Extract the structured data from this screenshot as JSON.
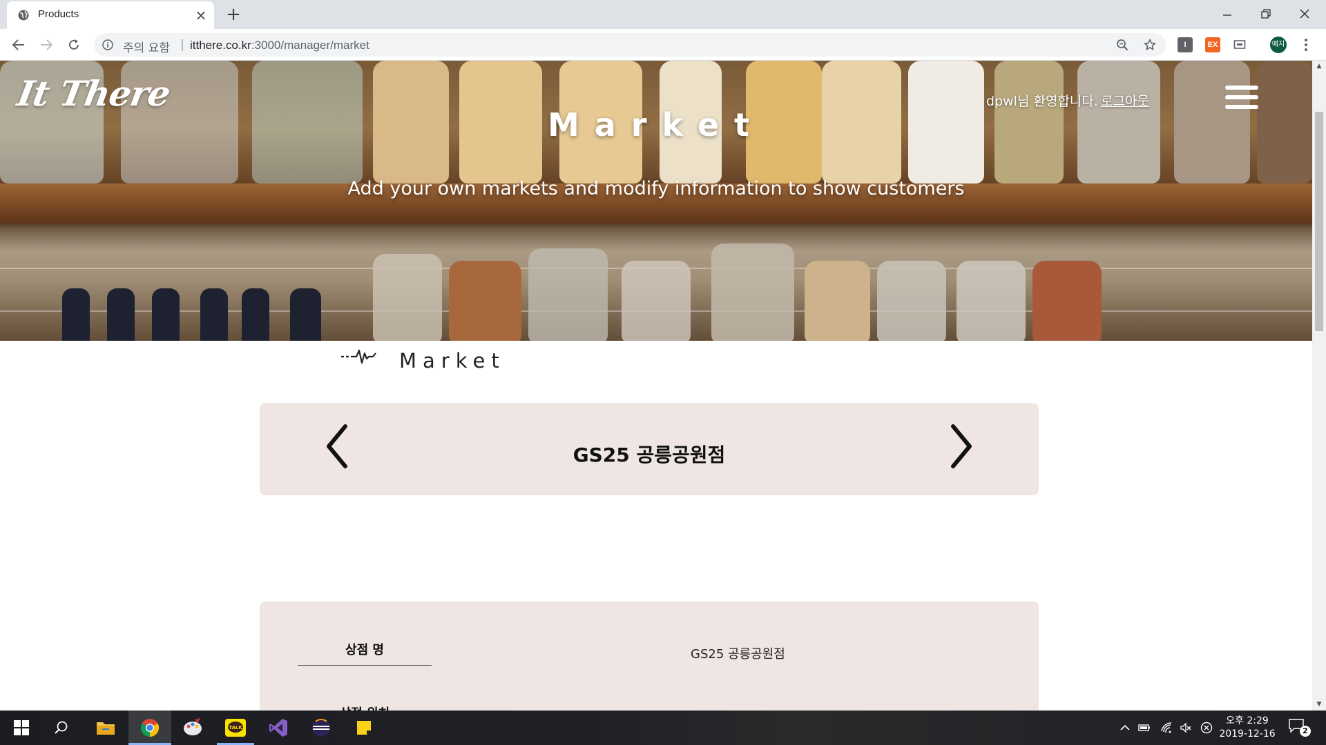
{
  "browser": {
    "tab_title": "Products",
    "security_label": "주의 요함",
    "url_host": "itthere.co.kr",
    "url_path": ":3000/manager/market",
    "profile_initials": "예지",
    "extensions": [
      {
        "name": "extension-i",
        "label": "I",
        "color": "#5f6368"
      },
      {
        "name": "extension-ex",
        "label": "EX",
        "color": "#f26522"
      },
      {
        "name": "extension-cast",
        "label": "",
        "color": "#5f6368"
      }
    ]
  },
  "site": {
    "logo": "It There",
    "hero_title": "Market",
    "hero_subtitle": "Add your own markets and modify information to show customers",
    "welcome_text": "dpwl님 환영합니다.",
    "logout_label": "로그아웃"
  },
  "section": {
    "title": "Market"
  },
  "selector": {
    "current_market": "GS25 공릉공원점",
    "prev_icon": "chevron-left-icon",
    "next_icon": "chevron-right-icon"
  },
  "info": {
    "fields": [
      {
        "label": "상점 명",
        "value": "GS25 공릉공원점"
      },
      {
        "label": "상점 위치",
        "value": ""
      }
    ]
  },
  "taskbar": {
    "apps": [
      "windows-start",
      "search",
      "file-explorer",
      "chrome",
      "paint-app",
      "kakaotalk",
      "visual-studio",
      "eclipse",
      "sticky-notes"
    ],
    "kakao_label": "TALK",
    "time": "오후 2:29",
    "date": "2019-12-16",
    "notification_count": "2"
  },
  "colors": {
    "card_bg": "#efe6e4",
    "accent_blue": "#8ab4f8"
  }
}
